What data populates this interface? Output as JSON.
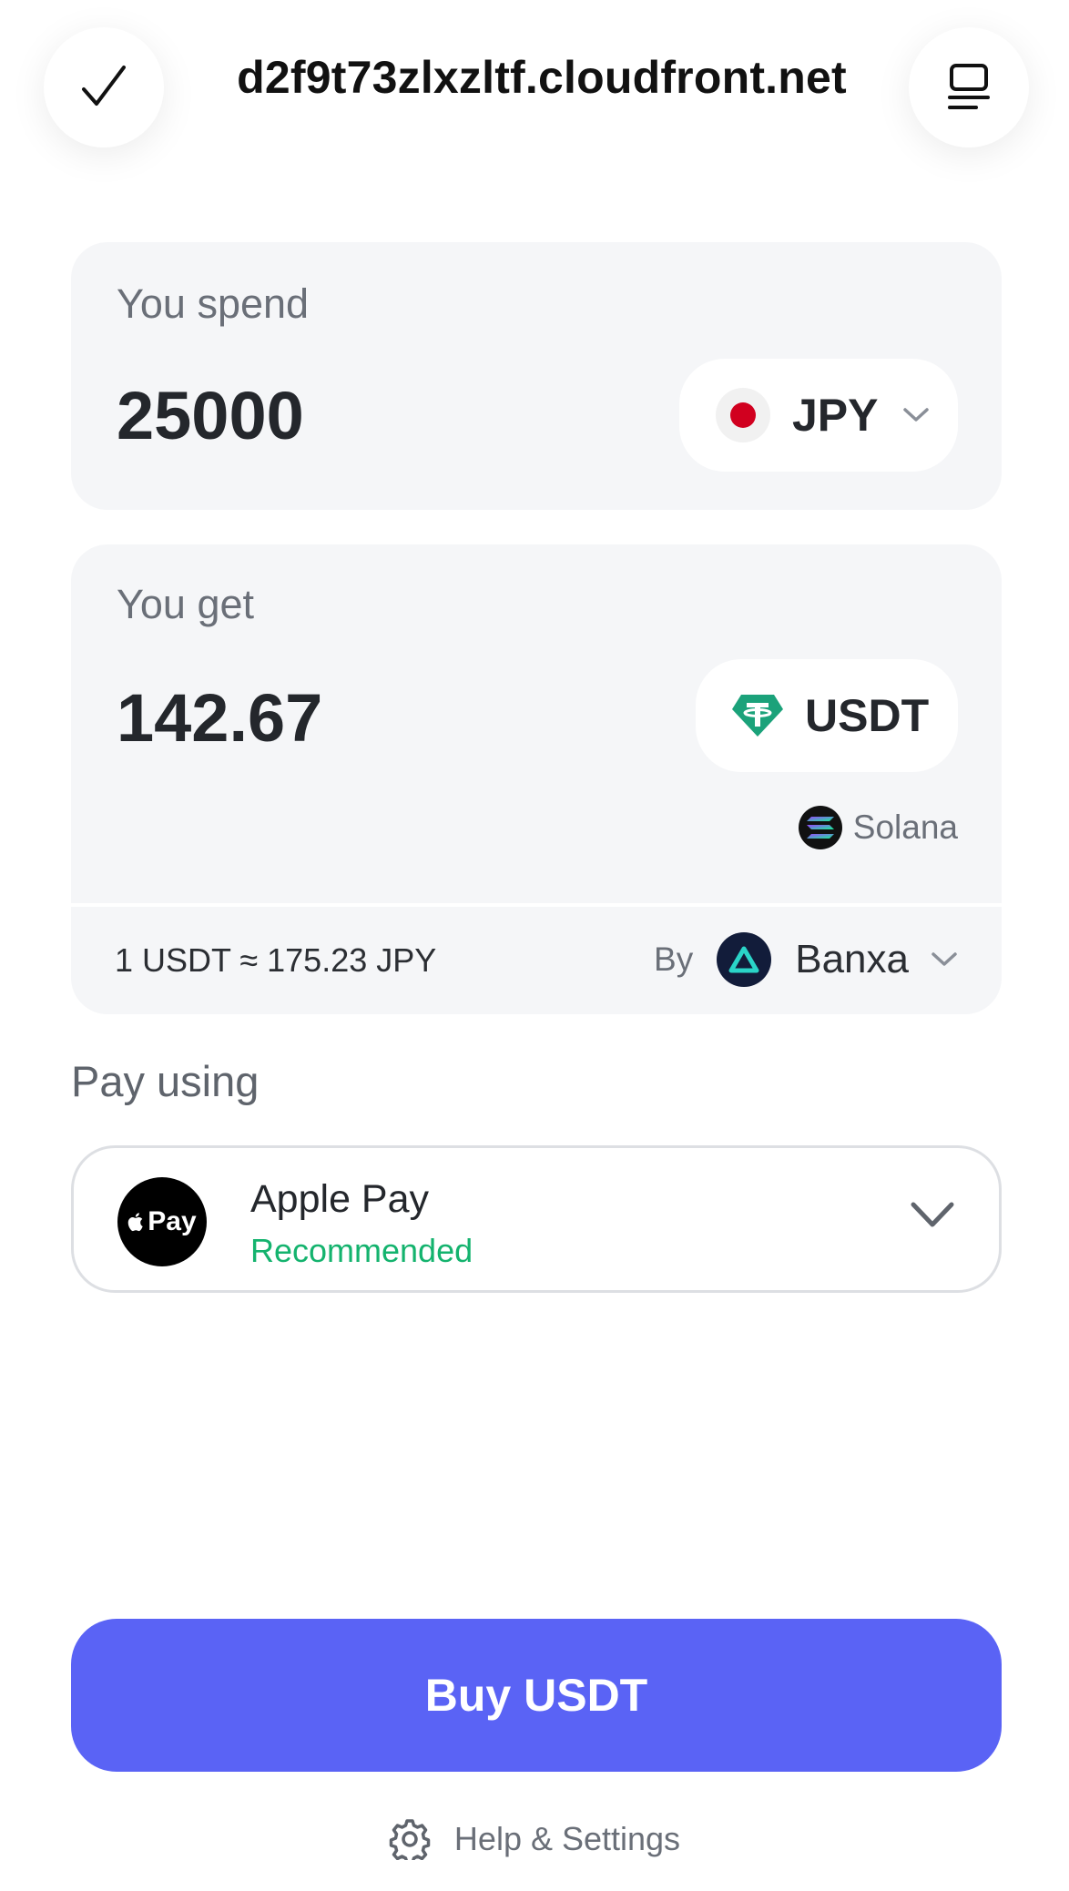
{
  "header": {
    "domain": "d2f9t73zlxzltf.cloudfront.net",
    "left_icon": "checkmark-icon",
    "right_icon": "receipt-menu-icon"
  },
  "spend": {
    "label": "You spend",
    "amount": "25000",
    "currency": "JPY",
    "currency_icon": "japan-flag-icon"
  },
  "get": {
    "label": "You get",
    "amount": "142.67",
    "currency": "USDT",
    "currency_icon": "tether-icon",
    "network": "Solana",
    "network_icon": "solana-icon"
  },
  "rate": {
    "text": "1 USDT ≈ 175.23 JPY",
    "by_label": "By",
    "provider": "Banxa",
    "provider_icon": "banxa-icon"
  },
  "payment": {
    "section_label": "Pay using",
    "method_name": "Apple Pay",
    "method_badge": "Recommended",
    "logo_text": "Pay",
    "logo_icon": "apple-pay-icon"
  },
  "actions": {
    "buy_label": "Buy USDT",
    "help_label": "Help & Settings",
    "help_icon": "gear-icon"
  },
  "colors": {
    "primary": "#5a63f5",
    "success": "#14b36e",
    "card_bg": "#f5f6f8",
    "tether": "#1ba27a"
  }
}
